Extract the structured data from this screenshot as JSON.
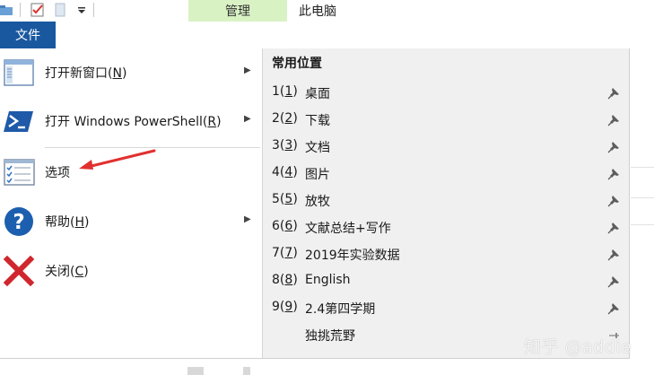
{
  "titlebar": {
    "manage_tab": "管理",
    "window_title": "此电脑"
  },
  "file_tab": {
    "label": "文件"
  },
  "menu": {
    "items": [
      {
        "label": "打开新窗口(",
        "mnemonic": "N",
        "suffix": ")",
        "icon": "new-window-icon",
        "has_submenu": true
      },
      {
        "label": "打开 Windows PowerShell(",
        "mnemonic": "R",
        "suffix": ")",
        "icon": "powershell-icon",
        "has_submenu": true
      },
      {
        "label": "选项",
        "mnemonic": "",
        "suffix": "",
        "icon": "options-icon",
        "has_submenu": false
      },
      {
        "label": "帮助(",
        "mnemonic": "H",
        "suffix": ")",
        "icon": "help-icon",
        "has_submenu": true
      },
      {
        "label": "关闭(",
        "mnemonic": "C",
        "suffix": ")",
        "icon": "close-icon",
        "has_submenu": false
      }
    ],
    "submenu_arrow": "▶"
  },
  "frequent": {
    "title": "常用位置",
    "items": [
      {
        "num": "1",
        "mnemonic": "1",
        "name": "桌面",
        "pinned": true
      },
      {
        "num": "2",
        "mnemonic": "2",
        "name": "下载",
        "pinned": true
      },
      {
        "num": "3",
        "mnemonic": "3",
        "name": "文档",
        "pinned": true
      },
      {
        "num": "4",
        "mnemonic": "4",
        "name": "图片",
        "pinned": true
      },
      {
        "num": "5",
        "mnemonic": "5",
        "name": "放牧",
        "pinned": true
      },
      {
        "num": "6",
        "mnemonic": "6",
        "name": "文献总结+写作",
        "pinned": true
      },
      {
        "num": "7",
        "mnemonic": "7",
        "name": "2019年实验数据",
        "pinned": true
      },
      {
        "num": "8",
        "mnemonic": "8",
        "name": "English",
        "pinned": true
      },
      {
        "num": "9",
        "mnemonic": "9",
        "name": "2.4第四学期",
        "pinned": true
      },
      {
        "num": "",
        "mnemonic": "",
        "name": "独挑荒野",
        "pinned": false
      }
    ]
  },
  "watermark": "知乎 @addie",
  "colors": {
    "file_tab_bg": "#19589e",
    "manage_tab_bg": "#d9f2c4",
    "right_pane_bg": "#f0f0f0",
    "annotation_arrow": "#e0312f"
  }
}
